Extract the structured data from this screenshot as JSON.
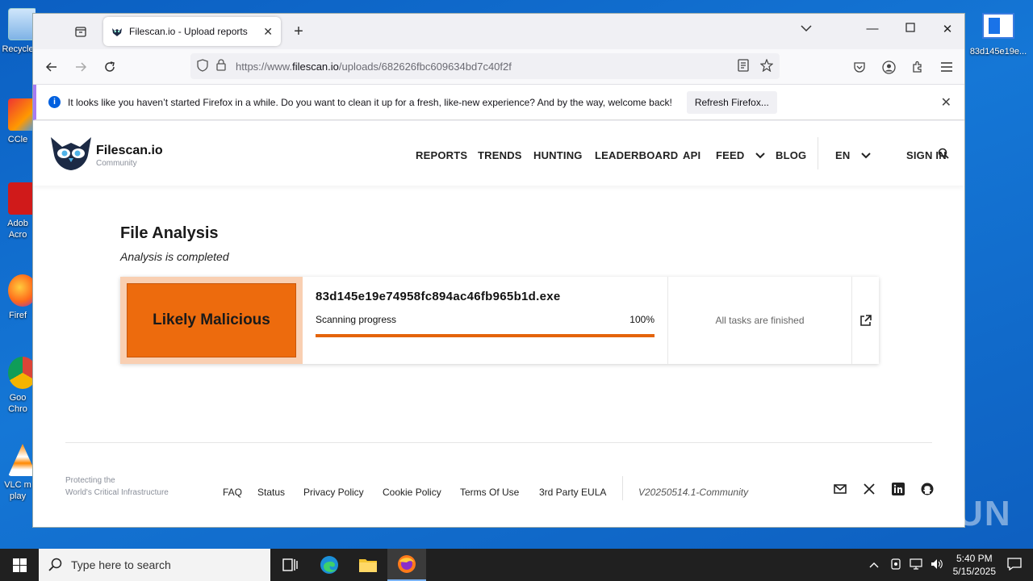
{
  "desktop": {
    "icons": [
      {
        "label": "Recycle"
      },
      {
        "label": "CCle"
      },
      {
        "label": "Adob Acro"
      },
      {
        "label": "Firef"
      },
      {
        "label": "Goo Chro"
      },
      {
        "label": "VLC m play"
      }
    ],
    "right_icon_label": "83d145e19e...",
    "watermark": "ANY RUN"
  },
  "browser": {
    "tab_title": "Filescan.io - Upload reports",
    "url_prefix": "https://www.",
    "url_domain": "filescan.io",
    "url_path": "/uploads/682626fbc609634bd7c40f2f",
    "notification": {
      "text": "It looks like you haven’t started Firefox in a while. Do you want to clean it up for a fresh, like-new experience? And by the way, welcome back!",
      "button": "Refresh Firefox..."
    }
  },
  "site": {
    "brand": "Filescan.io",
    "brand_sub": "Community",
    "menu": [
      "REPORTS",
      "TRENDS",
      "HUNTING",
      "LEADERBOARD",
      "API",
      "FEED",
      "BLOG"
    ],
    "lang": "EN",
    "signin": "SIGN IN"
  },
  "analysis": {
    "title": "File Analysis",
    "status": "Analysis is completed",
    "verdict": "Likely Malicious",
    "filename": "83d145e19e74958fc894ac46fb965b1d.exe",
    "progress_label": "Scanning progress",
    "progress_text": "100%",
    "progress_fraction": 1.0,
    "tasks_status": "All tasks are finished"
  },
  "footer": {
    "tagline_1": "Protecting the",
    "tagline_2": "World's Critical Infrastructure",
    "links": [
      "FAQ",
      "Status",
      "Privacy Policy",
      "Cookie Policy",
      "Terms Of Use",
      "3rd Party EULA"
    ],
    "version": "V20250514.1-Community"
  },
  "taskbar": {
    "search_placeholder": "Type here to search",
    "time": "5:40 PM",
    "date": "5/15/2025"
  },
  "colors": {
    "verdict_bg": "#ed6b0d",
    "verdict_frame": "#f9cfb2",
    "progress": "#e4640a",
    "notification_accent": "#a67cf3"
  }
}
